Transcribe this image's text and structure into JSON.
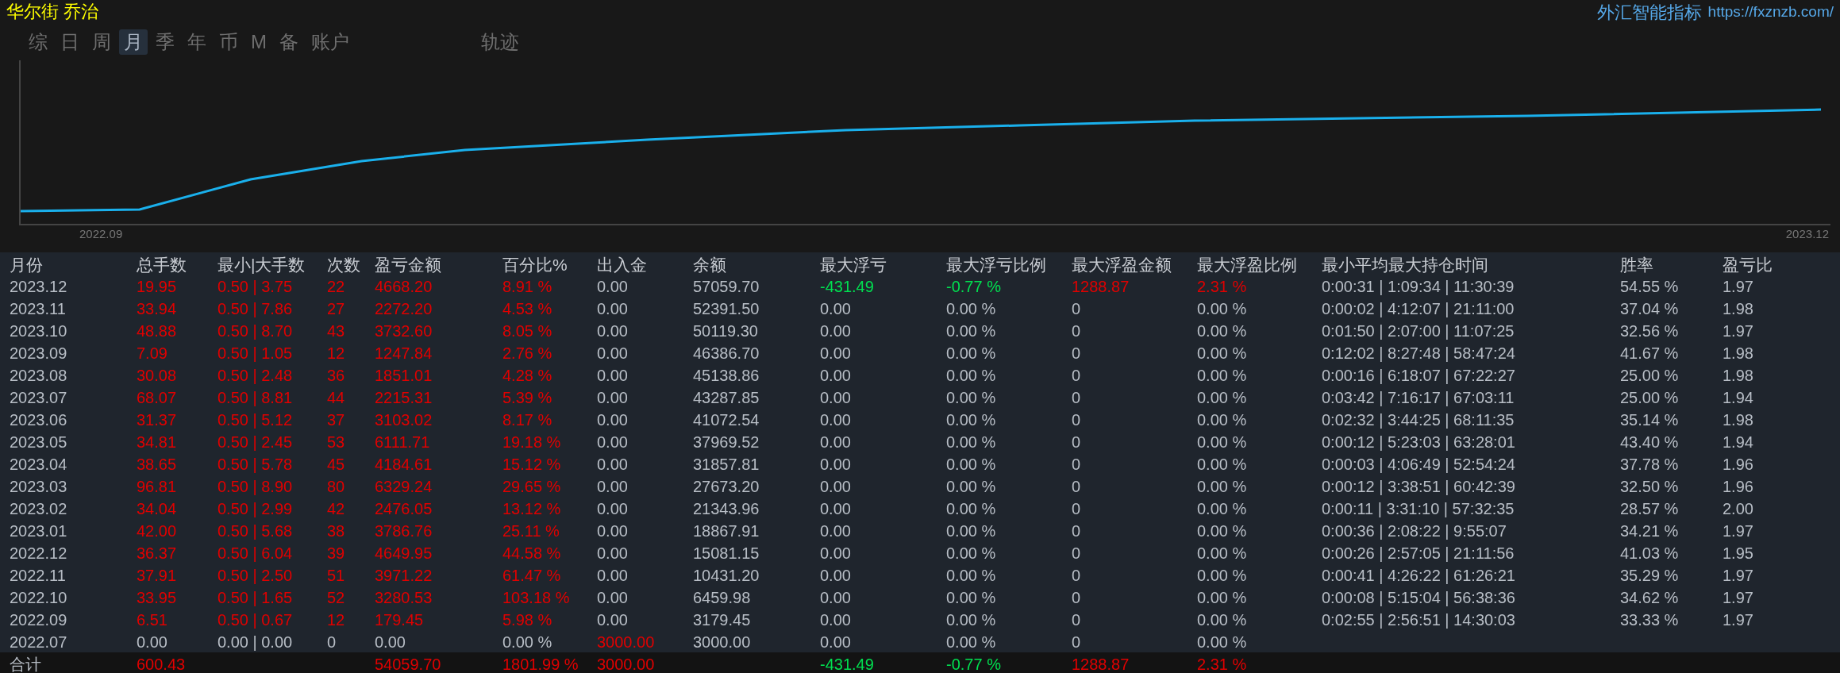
{
  "title": "华尔街 乔治",
  "brand": {
    "name": "外汇智能指标",
    "url": "https://fxznzb.com/"
  },
  "tabs": [
    {
      "label": "综",
      "selected": false
    },
    {
      "label": "日",
      "selected": false
    },
    {
      "label": "周",
      "selected": false
    },
    {
      "label": "月",
      "selected": true
    },
    {
      "label": "季",
      "selected": false
    },
    {
      "label": "年",
      "selected": false
    },
    {
      "label": "币",
      "selected": false
    },
    {
      "label": "M",
      "selected": false
    },
    {
      "label": "备",
      "selected": false
    },
    {
      "label": "账户",
      "selected": false
    },
    {
      "label": "轨迹",
      "selected": false
    }
  ],
  "chart": {
    "x_start": "2022.09",
    "x_end": "2023.12"
  },
  "table": {
    "columns": [
      "月份",
      "总手数",
      "最小|大手数",
      "次数",
      "盈亏金额",
      "百分比%",
      "出入金",
      "余额",
      "最大浮亏",
      "最大浮亏比例",
      "最大浮盈金额",
      "最大浮盈比例",
      "最小平均最大持仓时间",
      "胜率",
      "盈亏比"
    ],
    "rows": [
      {
        "kind": "month",
        "cells": [
          "2023.12",
          {
            "text": "19.95",
            "color": "#e00000"
          },
          {
            "text": "0.50 | 3.75",
            "color": "#e00000"
          },
          {
            "text": "22",
            "color": "#e00000"
          },
          {
            "text": "4668.20",
            "color": "#e00000"
          },
          {
            "text": "8.91 %",
            "color": "#e00000"
          },
          "0.00",
          "57059.70",
          {
            "text": "-431.49",
            "color": "#00e050"
          },
          {
            "text": "-0.77 %",
            "color": "#00e050"
          },
          {
            "text": "1288.87",
            "color": "#e00000"
          },
          {
            "text": "2.31 %",
            "color": "#e00000"
          },
          "0:00:31 | 1:09:34 | 11:30:39",
          "54.55 %",
          "1.97"
        ]
      },
      {
        "kind": "month",
        "cells": [
          "2023.11",
          {
            "text": "33.94",
            "color": "#e00000"
          },
          {
            "text": "0.50 | 7.86",
            "color": "#e00000"
          },
          {
            "text": "27",
            "color": "#e00000"
          },
          {
            "text": "2272.20",
            "color": "#e00000"
          },
          {
            "text": "4.53 %",
            "color": "#e00000"
          },
          "0.00",
          "52391.50",
          "0.00",
          "0.00 %",
          "0",
          "0.00 %",
          "0:00:02 | 4:12:07 | 21:11:00",
          "37.04 %",
          "1.98"
        ]
      },
      {
        "kind": "month",
        "cells": [
          "2023.10",
          {
            "text": "48.88",
            "color": "#e00000"
          },
          {
            "text": "0.50 | 8.70",
            "color": "#e00000"
          },
          {
            "text": "43",
            "color": "#e00000"
          },
          {
            "text": "3732.60",
            "color": "#e00000"
          },
          {
            "text": "8.05 %",
            "color": "#e00000"
          },
          "0.00",
          "50119.30",
          "0.00",
          "0.00 %",
          "0",
          "0.00 %",
          "0:01:50 | 2:07:00 | 11:07:25",
          "32.56 %",
          "1.97"
        ]
      },
      {
        "kind": "month",
        "cells": [
          "2023.09",
          {
            "text": "7.09",
            "color": "#e00000"
          },
          {
            "text": "0.50 | 1.05",
            "color": "#e00000"
          },
          {
            "text": "12",
            "color": "#e00000"
          },
          {
            "text": "1247.84",
            "color": "#e00000"
          },
          {
            "text": "2.76 %",
            "color": "#e00000"
          },
          "0.00",
          "46386.70",
          "0.00",
          "0.00 %",
          "0",
          "0.00 %",
          "0:12:02 | 8:27:48 | 58:47:24",
          "41.67 %",
          "1.98"
        ]
      },
      {
        "kind": "month",
        "cells": [
          "2023.08",
          {
            "text": "30.08",
            "color": "#e00000"
          },
          {
            "text": "0.50 | 2.48",
            "color": "#e00000"
          },
          {
            "text": "36",
            "color": "#e00000"
          },
          {
            "text": "1851.01",
            "color": "#e00000"
          },
          {
            "text": "4.28 %",
            "color": "#e00000"
          },
          "0.00",
          "45138.86",
          "0.00",
          "0.00 %",
          "0",
          "0.00 %",
          "0:00:16 | 6:18:07 | 67:22:27",
          "25.00 %",
          "1.98"
        ]
      },
      {
        "kind": "month",
        "cells": [
          "2023.07",
          {
            "text": "68.07",
            "color": "#e00000"
          },
          {
            "text": "0.50 | 8.81",
            "color": "#e00000"
          },
          {
            "text": "44",
            "color": "#e00000"
          },
          {
            "text": "2215.31",
            "color": "#e00000"
          },
          {
            "text": "5.39 %",
            "color": "#e00000"
          },
          "0.00",
          "43287.85",
          "0.00",
          "0.00 %",
          "0",
          "0.00 %",
          "0:03:42 | 7:16:17 | 67:03:11",
          "25.00 %",
          "1.94"
        ]
      },
      {
        "kind": "month",
        "cells": [
          "2023.06",
          {
            "text": "31.37",
            "color": "#e00000"
          },
          {
            "text": "0.50 | 5.12",
            "color": "#e00000"
          },
          {
            "text": "37",
            "color": "#e00000"
          },
          {
            "text": "3103.02",
            "color": "#e00000"
          },
          {
            "text": "8.17 %",
            "color": "#e00000"
          },
          "0.00",
          "41072.54",
          "0.00",
          "0.00 %",
          "0",
          "0.00 %",
          "0:02:32 | 3:44:25 | 68:11:35",
          "35.14 %",
          "1.98"
        ]
      },
      {
        "kind": "month",
        "cells": [
          "2023.05",
          {
            "text": "34.81",
            "color": "#e00000"
          },
          {
            "text": "0.50 | 2.45",
            "color": "#e00000"
          },
          {
            "text": "53",
            "color": "#e00000"
          },
          {
            "text": "6111.71",
            "color": "#e00000"
          },
          {
            "text": "19.18 %",
            "color": "#e00000"
          },
          "0.00",
          "37969.52",
          "0.00",
          "0.00 %",
          "0",
          "0.00 %",
          "0:00:12 | 5:23:03 | 63:28:01",
          "43.40 %",
          "1.94"
        ]
      },
      {
        "kind": "month",
        "cells": [
          "2023.04",
          {
            "text": "38.65",
            "color": "#e00000"
          },
          {
            "text": "0.50 | 5.78",
            "color": "#e00000"
          },
          {
            "text": "45",
            "color": "#e00000"
          },
          {
            "text": "4184.61",
            "color": "#e00000"
          },
          {
            "text": "15.12 %",
            "color": "#e00000"
          },
          "0.00",
          "31857.81",
          "0.00",
          "0.00 %",
          "0",
          "0.00 %",
          "0:00:03 | 4:06:49 | 52:54:24",
          "37.78 %",
          "1.96"
        ]
      },
      {
        "kind": "month",
        "cells": [
          "2023.03",
          {
            "text": "96.81",
            "color": "#e00000"
          },
          {
            "text": "0.50 | 8.90",
            "color": "#e00000"
          },
          {
            "text": "80",
            "color": "#e00000"
          },
          {
            "text": "6329.24",
            "color": "#e00000"
          },
          {
            "text": "29.65 %",
            "color": "#e00000"
          },
          "0.00",
          "27673.20",
          "0.00",
          "0.00 %",
          "0",
          "0.00 %",
          "0:00:12 | 3:38:51 | 60:42:39",
          "32.50 %",
          "1.96"
        ]
      },
      {
        "kind": "month",
        "cells": [
          "2023.02",
          {
            "text": "34.04",
            "color": "#e00000"
          },
          {
            "text": "0.50 | 2.99",
            "color": "#e00000"
          },
          {
            "text": "42",
            "color": "#e00000"
          },
          {
            "text": "2476.05",
            "color": "#e00000"
          },
          {
            "text": "13.12 %",
            "color": "#e00000"
          },
          "0.00",
          "21343.96",
          "0.00",
          "0.00 %",
          "0",
          "0.00 %",
          "0:00:11 | 3:31:10 | 57:32:35",
          "28.57 %",
          "2.00"
        ]
      },
      {
        "kind": "month",
        "cells": [
          "2023.01",
          {
            "text": "42.00",
            "color": "#e00000"
          },
          {
            "text": "0.50 | 5.68",
            "color": "#e00000"
          },
          {
            "text": "38",
            "color": "#e00000"
          },
          {
            "text": "3786.76",
            "color": "#e00000"
          },
          {
            "text": "25.11 %",
            "color": "#e00000"
          },
          "0.00",
          "18867.91",
          "0.00",
          "0.00 %",
          "0",
          "0.00 %",
          "0:00:36 | 2:08:22 | 9:55:07",
          "34.21 %",
          "1.97"
        ]
      },
      {
        "kind": "month",
        "cells": [
          "2022.12",
          {
            "text": "36.37",
            "color": "#e00000"
          },
          {
            "text": "0.50 | 6.04",
            "color": "#e00000"
          },
          {
            "text": "39",
            "color": "#e00000"
          },
          {
            "text": "4649.95",
            "color": "#e00000"
          },
          {
            "text": "44.58 %",
            "color": "#e00000"
          },
          "0.00",
          "15081.15",
          "0.00",
          "0.00 %",
          "0",
          "0.00 %",
          "0:00:26 | 2:57:05 | 21:11:56",
          "41.03 %",
          "1.95"
        ]
      },
      {
        "kind": "month",
        "cells": [
          "2022.11",
          {
            "text": "37.91",
            "color": "#e00000"
          },
          {
            "text": "0.50 | 2.50",
            "color": "#e00000"
          },
          {
            "text": "51",
            "color": "#e00000"
          },
          {
            "text": "3971.22",
            "color": "#e00000"
          },
          {
            "text": "61.47 %",
            "color": "#e00000"
          },
          "0.00",
          "10431.20",
          "0.00",
          "0.00 %",
          "0",
          "0.00 %",
          "0:00:41 | 4:26:22 | 61:26:21",
          "35.29 %",
          "1.97"
        ]
      },
      {
        "kind": "month",
        "cells": [
          "2022.10",
          {
            "text": "33.95",
            "color": "#e00000"
          },
          {
            "text": "0.50 | 1.65",
            "color": "#e00000"
          },
          {
            "text": "52",
            "color": "#e00000"
          },
          {
            "text": "3280.53",
            "color": "#e00000"
          },
          {
            "text": "103.18 %",
            "color": "#e00000"
          },
          "0.00",
          "6459.98",
          "0.00",
          "0.00 %",
          "0",
          "0.00 %",
          "0:00:08 | 5:15:04 | 56:38:36",
          "34.62 %",
          "1.97"
        ]
      },
      {
        "kind": "month",
        "cells": [
          "2022.09",
          {
            "text": "6.51",
            "color": "#e00000"
          },
          {
            "text": "0.50 | 0.67",
            "color": "#e00000"
          },
          {
            "text": "12",
            "color": "#e00000"
          },
          {
            "text": "179.45",
            "color": "#e00000"
          },
          {
            "text": "5.98 %",
            "color": "#e00000"
          },
          "0.00",
          "3179.45",
          "0.00",
          "0.00 %",
          "0",
          "0.00 %",
          "0:02:55 | 2:56:51 | 14:30:03",
          "33.33 %",
          "1.97"
        ]
      },
      {
        "kind": "month",
        "cells": [
          "2022.07",
          "0.00",
          "0.00 | 0.00",
          "0",
          "0.00",
          "0.00 %",
          {
            "text": "3000.00",
            "color": "#e00000"
          },
          "3000.00",
          "0.00",
          "0.00 %",
          "0",
          "0.00 %"
        ]
      },
      {
        "kind": "total",
        "cells": [
          "合计",
          {
            "text": "600.43",
            "color": "#e00000"
          },
          "",
          "",
          {
            "text": "54059.70",
            "color": "#e00000"
          },
          {
            "text": "1801.99 %",
            "color": "#e00000"
          },
          {
            "text": "3000.00",
            "color": "#e00000"
          },
          "",
          {
            "text": "-431.49",
            "color": "#00e050"
          },
          {
            "text": "-0.77 %",
            "color": "#00e050"
          },
          {
            "text": "1288.87",
            "color": "#e00000"
          },
          {
            "text": "2.31 %",
            "color": "#e00000"
          }
        ]
      }
    ]
  }
}
